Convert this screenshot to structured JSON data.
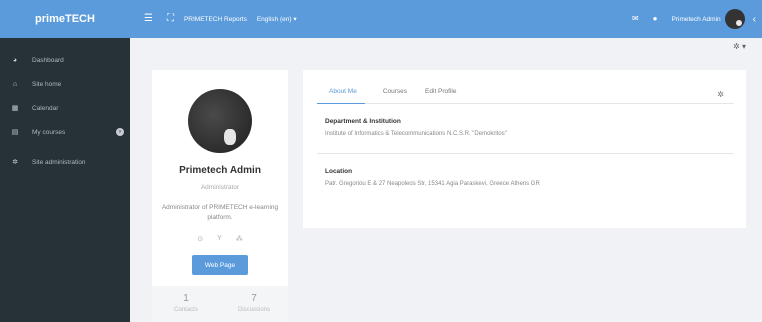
{
  "topbar": {
    "brand": "primeTECH",
    "menu_icon": "hamburger-icon",
    "fullscreen_icon": "expand-icon",
    "reports_link": "PRIMETECH Reports",
    "language": "English (en)",
    "language_caret": "▾",
    "mail_icon": "envelope-icon",
    "bell_icon": "bell-icon",
    "user_name": "Primetech Admin",
    "collapse_icon": "chevron-left-icon"
  },
  "sidebar": {
    "items": [
      {
        "label": "Dashboard",
        "icon": "dashboard-icon"
      },
      {
        "label": "Site home",
        "icon": "home-icon"
      },
      {
        "label": "Calendar",
        "icon": "calendar-icon"
      },
      {
        "label": "My courses",
        "icon": "courses-icon",
        "badge": "›"
      },
      {
        "label": "Site administration",
        "icon": "gear-icon"
      }
    ]
  },
  "profile": {
    "name": "Primetech Admin",
    "role": "Administrator",
    "description": "Administrator of PRIMETECH e-learning platform.",
    "icons": [
      "skype-icon",
      "yahoo-icon",
      "msn-icon"
    ],
    "web_button": "Web Page",
    "stats": [
      {
        "value": "1",
        "label": "Contacts"
      },
      {
        "value": "7",
        "label": "Discussions"
      }
    ]
  },
  "info": {
    "tabs": [
      "About Me",
      "Courses",
      "Edit Profile"
    ],
    "sections": [
      {
        "title": "Department & Institution",
        "text": "Institute of Informatics & Telecommunications N.C.S.R. \"Demokritos\""
      },
      {
        "title": "Location",
        "text": "Patr. Gregoriou E & 27 Neapoleos Str, 15341 Agia Paraskevi, Greece Athens GR"
      }
    ]
  },
  "colors": {
    "topbar": "#5b9bdc",
    "sidebar": "#263238",
    "accent": "#5b9bdc"
  }
}
